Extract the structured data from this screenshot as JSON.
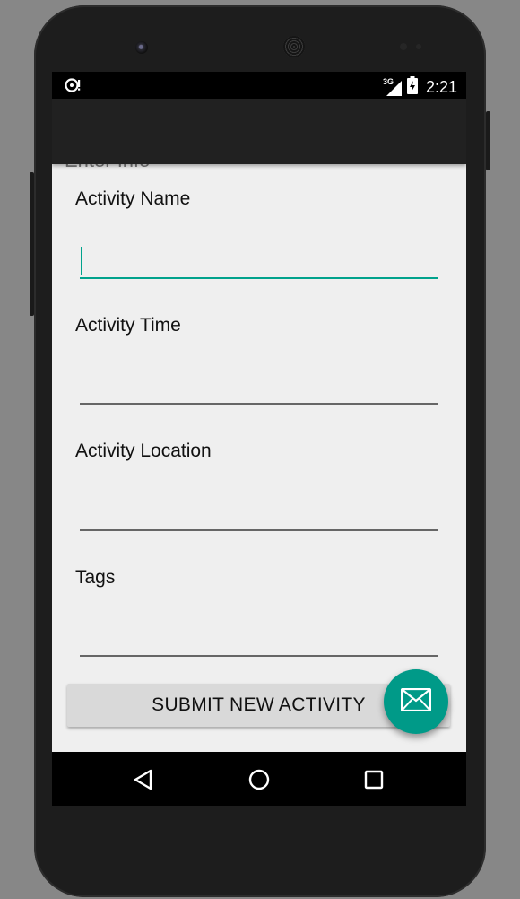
{
  "status_bar": {
    "notification_icon": "sync-alert-icon",
    "network_label": "3G",
    "time": "2:21"
  },
  "heading": "Enter Info",
  "form": {
    "fields": [
      {
        "label": "Activity Name",
        "value": ""
      },
      {
        "label": "Activity Time",
        "value": ""
      },
      {
        "label": "Activity Location",
        "value": ""
      },
      {
        "label": "Tags",
        "value": ""
      }
    ],
    "submit_label": "SUBMIT NEW ACTIVITY"
  },
  "fab_icon": "email-icon",
  "nav_bar": {
    "icons": [
      "back-icon",
      "home-icon",
      "recents-icon"
    ]
  },
  "colors": {
    "accent": "#009a88",
    "app_bar": "#212121",
    "background": "#efefef"
  }
}
